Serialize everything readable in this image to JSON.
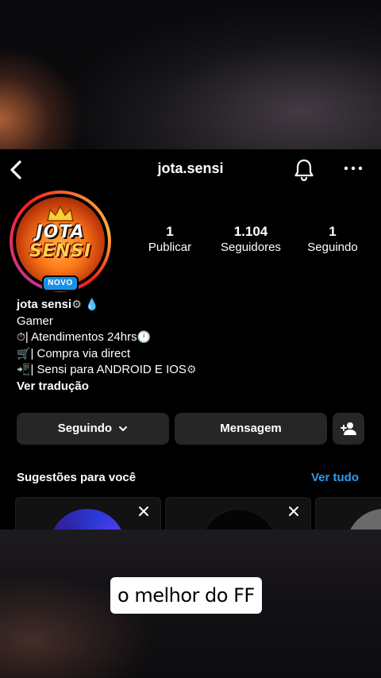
{
  "header": {
    "username": "jota.sensi",
    "back_icon": "chevron-left-icon",
    "bell_icon": "bell-icon",
    "more_icon": "more-horizontal-icon"
  },
  "avatar": {
    "logo_line1": "JOTA",
    "logo_line2": "SENSI",
    "badge": "NOVO"
  },
  "stats": [
    {
      "value": "1",
      "label": "Publicar"
    },
    {
      "value": "1.104",
      "label": "Seguidores"
    },
    {
      "value": "1",
      "label": "Seguindo"
    }
  ],
  "bio": {
    "name": "jota sensi",
    "category": "Gamer",
    "lines": [
      "| Atendimentos 24hrs",
      "| Compra via direct",
      "| Sensi para ANDROID E IOS"
    ],
    "translate": "Ver tradução"
  },
  "actions": {
    "following_label": "Seguindo",
    "message_label": "Mensagem",
    "add_user_icon": "add-user-icon"
  },
  "suggestions": {
    "title": "Sugestões para você",
    "see_all": "Ver tudo"
  },
  "caption": "o melhor do FF",
  "colors": {
    "link": "#2e9bf0",
    "button_bg": "#262626",
    "badge": "#1a8fe8"
  }
}
